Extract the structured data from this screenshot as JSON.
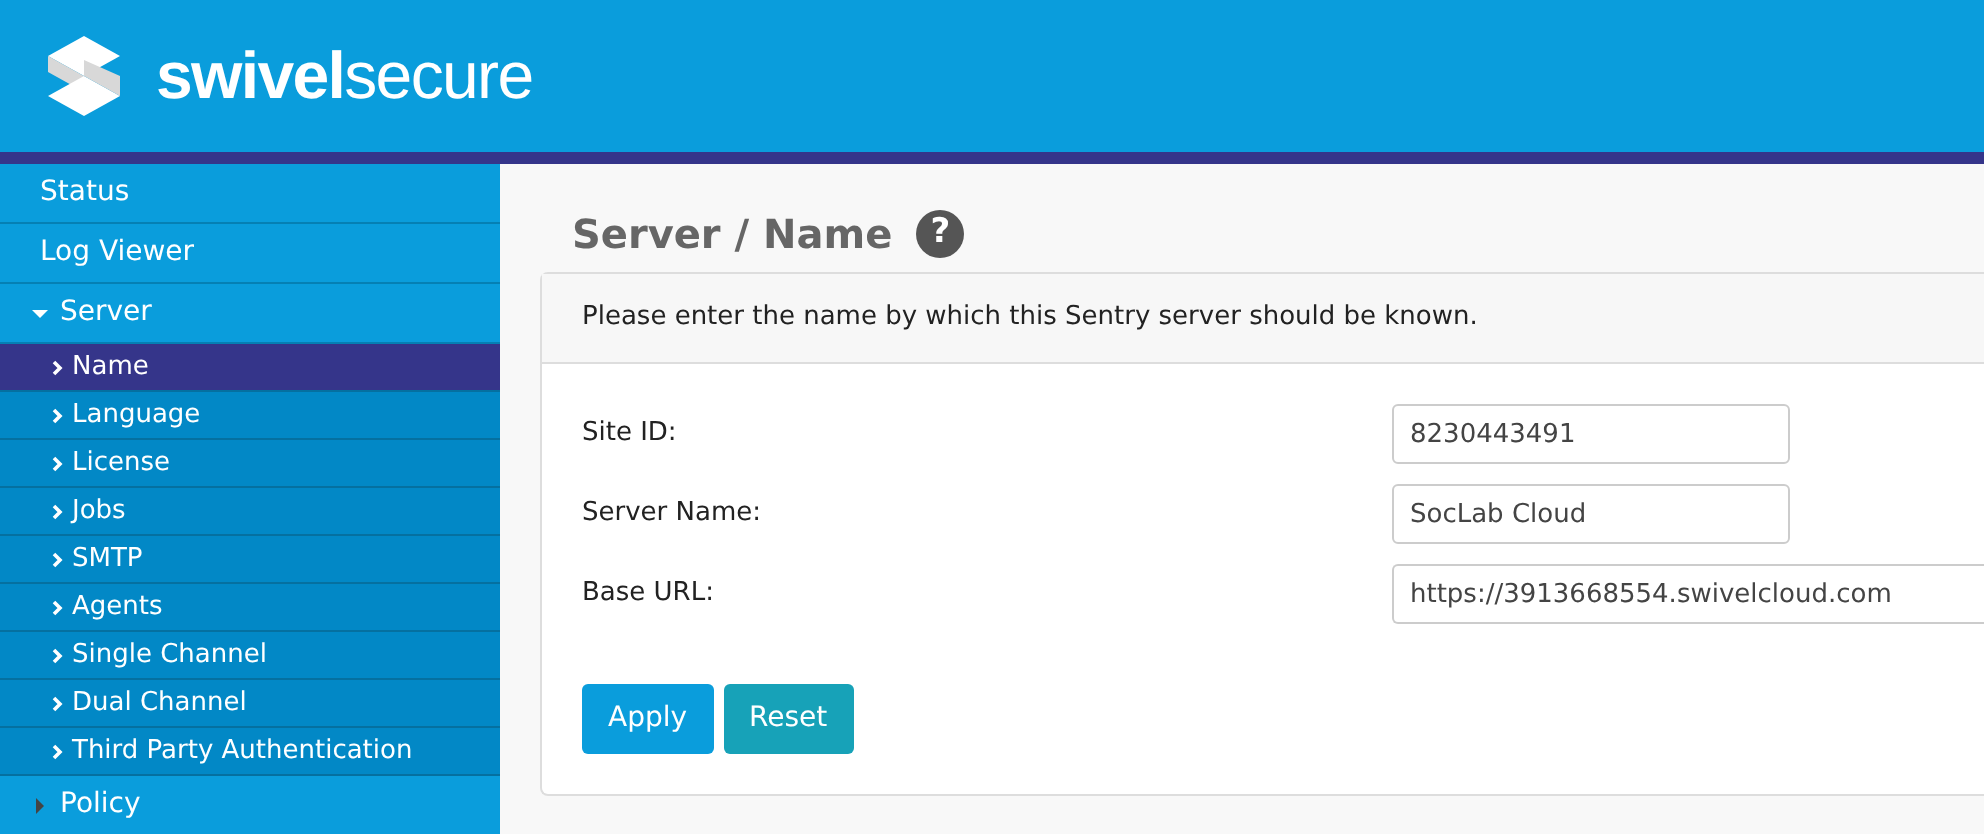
{
  "header": {
    "logo_bold": "swivel",
    "logo_light": "secure"
  },
  "sidebar": {
    "items": [
      {
        "label": "Status",
        "selected": false
      },
      {
        "label": "Log Viewer",
        "selected": false
      },
      {
        "label": "Server",
        "selected": false,
        "expanded": true,
        "children": [
          {
            "label": "Name",
            "selected": true
          },
          {
            "label": "Language",
            "selected": false
          },
          {
            "label": "License",
            "selected": false
          },
          {
            "label": "Jobs",
            "selected": false
          },
          {
            "label": "SMTP",
            "selected": false
          },
          {
            "label": "Agents",
            "selected": false
          },
          {
            "label": "Single Channel",
            "selected": false
          },
          {
            "label": "Dual Channel",
            "selected": false
          },
          {
            "label": "Third Party Authentication",
            "selected": false
          }
        ]
      },
      {
        "label": "Policy",
        "selected": false,
        "expanded": false
      }
    ]
  },
  "page": {
    "title": "Server / Name",
    "help_icon": "?",
    "description": "Please enter the name by which this Sentry server should be known.",
    "fields": [
      {
        "label": "Site ID:",
        "value": "8230443491"
      },
      {
        "label": "Server Name:",
        "value": "SocLab Cloud"
      },
      {
        "label": "Base URL:",
        "value": "https://3913668554.swivelcloud.com",
        "wide": true
      }
    ],
    "buttons": [
      {
        "label": "Apply",
        "kind": "primary"
      },
      {
        "label": "Reset",
        "kind": "secondary"
      }
    ]
  }
}
